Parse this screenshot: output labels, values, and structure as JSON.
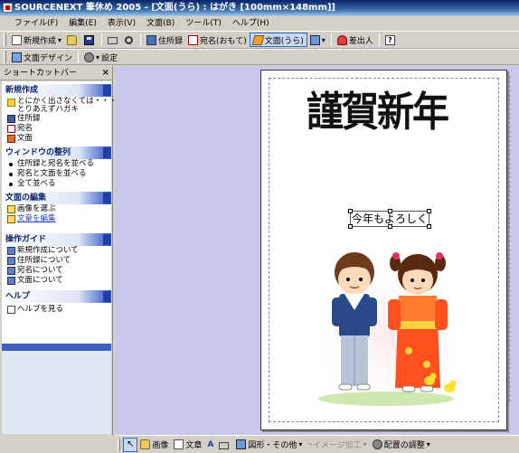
{
  "window": {
    "title": "SOURCENEXT 筆休め 2005 - [文面(うら) : はがき [100mm×148mm]]"
  },
  "menu": {
    "items": [
      "ファイル(F)",
      "編集(E)",
      "表示(V)",
      "文面(B)",
      "ツール(T)",
      "ヘルプ(H)"
    ]
  },
  "toolbar1": {
    "new_label": "新規作成",
    "address_label": "住所録",
    "omote_label": "宛名(おもて)",
    "ura_label": "文面(うら)",
    "sender_label": "差出人",
    "help_glyph": "?"
  },
  "toolbar2": {
    "design_label": "文面デザイン",
    "settings_label": "設定"
  },
  "sidebar": {
    "header": "ショートカットバー",
    "close_glyph": "×",
    "sections": {
      "new": {
        "title": "新規作成",
        "items": [
          "とにかく出さなくては・・・\nとりあえずハガキ",
          "住所録",
          "宛名",
          "文面"
        ]
      },
      "arrange": {
        "title": "ウィンドウの整列",
        "items": [
          "住所録と宛名を並べる",
          "宛名と文面を並べる",
          "全て並べる"
        ]
      },
      "edit": {
        "title": "文面の編集",
        "items": [
          "画像を選ぶ",
          "文章を編集"
        ]
      },
      "guide": {
        "title": "操作ガイド",
        "items": [
          "新規作成について",
          "住所録について",
          "宛名について",
          "文面について"
        ]
      },
      "help": {
        "title": "ヘルプ",
        "items": [
          "ヘルプを見る"
        ]
      }
    }
  },
  "card": {
    "greeting": "謹賀新年",
    "message": "今年もよろしく"
  },
  "bottombar": {
    "image_label": "画像",
    "text_label": "文章",
    "shape_label": "図形・その他",
    "image_edit_label": "イメージ加工",
    "arrange_label": "配置の調整"
  },
  "colors": {
    "titlebar": "#0a246a",
    "workspace": "#c8c8ec",
    "section_header": "#2850c8"
  }
}
